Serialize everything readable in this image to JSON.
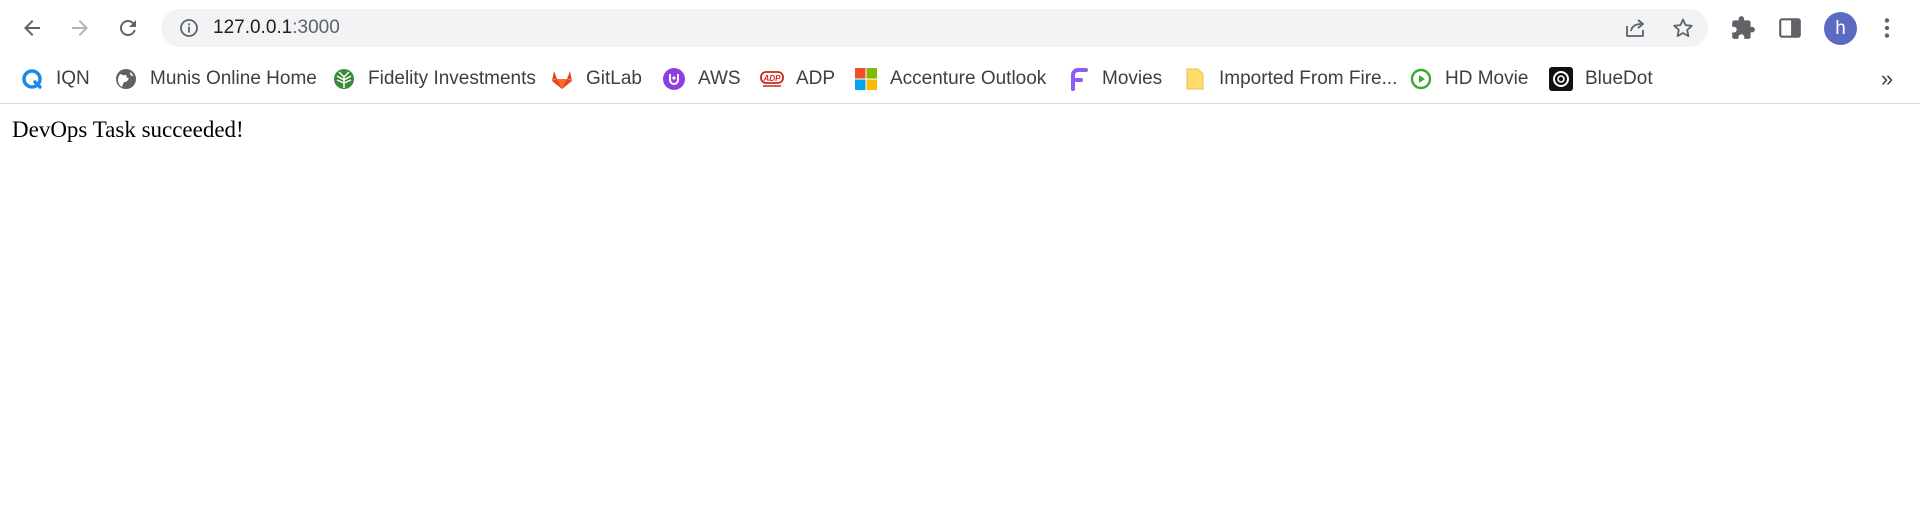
{
  "toolbar": {
    "url_host": "127.0.0.1",
    "url_port": ":3000",
    "avatar_initial": "h"
  },
  "bookmarks": [
    {
      "label": "IQN",
      "icon": "iqn-icon"
    },
    {
      "label": "Munis Online Home",
      "icon": "globe-icon"
    },
    {
      "label": "Fidelity Investments",
      "icon": "fidelity-icon"
    },
    {
      "label": "GitLab",
      "icon": "gitlab-icon"
    },
    {
      "label": "AWS",
      "icon": "aws-icon"
    },
    {
      "label": "ADP",
      "icon": "adp-icon"
    },
    {
      "label": "Accenture Outlook",
      "icon": "microsoft-icon"
    },
    {
      "label": "Movies",
      "icon": "movies-icon"
    },
    {
      "label": "Imported From Fire...",
      "icon": "folder-icon"
    },
    {
      "label": "HD Movie",
      "icon": "play-icon"
    },
    {
      "label": "BlueDot",
      "icon": "bluedot-icon"
    }
  ],
  "bookmarks_more": "»",
  "page": {
    "message": "DevOps Task succeeded!"
  },
  "colors": {
    "omnibox_bg": "#f1f3f4",
    "avatar_bg": "#5c6bc0",
    "icon_gray": "#5f6368",
    "disabled_gray": "#b0b3b8"
  }
}
